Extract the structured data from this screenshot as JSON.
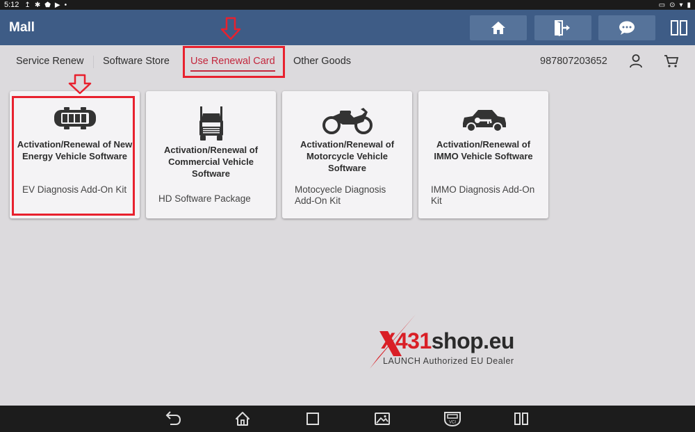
{
  "status_bar": {
    "time": "5:12",
    "left_icons": [
      "upload-icon",
      "bluetooth-icon",
      "shield-icon",
      "media-icon",
      "dot-icon"
    ],
    "right_icons": [
      "cast-icon",
      "location-icon",
      "wifi-icon",
      "battery-icon"
    ]
  },
  "header": {
    "title": "Mall",
    "buttons": [
      "home-icon",
      "exit-icon",
      "chat-icon",
      "split-screen-icon"
    ]
  },
  "tabs": [
    {
      "label": "Service Renew",
      "active": false
    },
    {
      "label": "Software Store",
      "active": false
    },
    {
      "label": "Use Renewal Card",
      "active": true
    },
    {
      "label": "Other Goods",
      "active": false
    }
  ],
  "account": {
    "serial": "987807203652"
  },
  "cards": [
    {
      "icon": "ev-battery-car-icon",
      "title": "Activation/Renewal of New Energy Vehicle Software",
      "subtitle": "EV Diagnosis Add-On Kit"
    },
    {
      "icon": "truck-icon",
      "title": "Activation/Renewal of Commercial Vehicle Software",
      "subtitle": "HD Software Package"
    },
    {
      "icon": "motorcycle-icon",
      "title": "Activation/Renewal of Motorcycle Vehicle Software",
      "subtitle": "Motocyecle Diagnosis Add-On Kit"
    },
    {
      "icon": "immo-car-key-icon",
      "title": "Activation/Renewal of IMMO Vehicle Software",
      "subtitle": "IMMO Diagnosis Add-On Kit"
    }
  ],
  "watermark": {
    "brand_red": "X431",
    "brand_dark": "shop.eu",
    "tagline": "LAUNCH Authorized EU Dealer"
  },
  "nav_bar": [
    "back-icon",
    "home-icon",
    "recent-apps-icon",
    "gallery-icon",
    "vci-icon",
    "split-screen-icon"
  ],
  "colors": {
    "header": "#3e5c86",
    "header_button": "#56739a",
    "accent_red": "#c3273d",
    "highlight": "#e8212e",
    "background": "#dcdadd",
    "card": "#f4f3f5"
  }
}
